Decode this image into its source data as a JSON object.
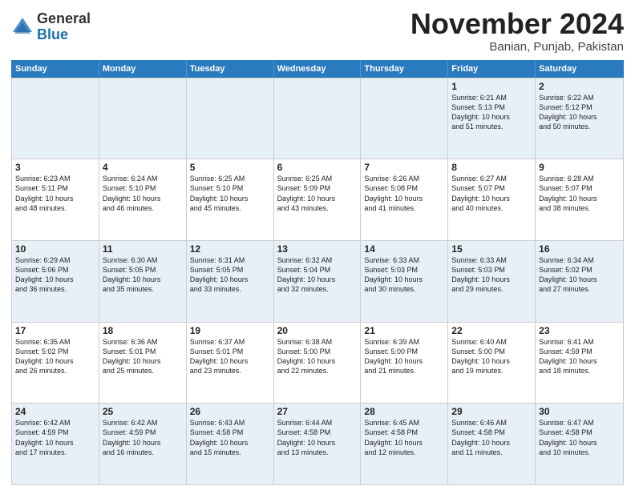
{
  "logo": {
    "general": "General",
    "blue": "Blue"
  },
  "title": "November 2024",
  "location": "Banian, Punjab, Pakistan",
  "days": [
    "Sunday",
    "Monday",
    "Tuesday",
    "Wednesday",
    "Thursday",
    "Friday",
    "Saturday"
  ],
  "rows": [
    [
      {
        "day": "",
        "lines": [],
        "empty": true
      },
      {
        "day": "",
        "lines": [],
        "empty": true
      },
      {
        "day": "",
        "lines": [],
        "empty": true
      },
      {
        "day": "",
        "lines": [],
        "empty": true
      },
      {
        "day": "",
        "lines": [],
        "empty": true
      },
      {
        "day": "1",
        "lines": [
          "Sunrise: 6:21 AM",
          "Sunset: 5:13 PM",
          "Daylight: 10 hours",
          "and 51 minutes."
        ]
      },
      {
        "day": "2",
        "lines": [
          "Sunrise: 6:22 AM",
          "Sunset: 5:12 PM",
          "Daylight: 10 hours",
          "and 50 minutes."
        ]
      }
    ],
    [
      {
        "day": "3",
        "lines": [
          "Sunrise: 6:23 AM",
          "Sunset: 5:11 PM",
          "Daylight: 10 hours",
          "and 48 minutes."
        ]
      },
      {
        "day": "4",
        "lines": [
          "Sunrise: 6:24 AM",
          "Sunset: 5:10 PM",
          "Daylight: 10 hours",
          "and 46 minutes."
        ]
      },
      {
        "day": "5",
        "lines": [
          "Sunrise: 6:25 AM",
          "Sunset: 5:10 PM",
          "Daylight: 10 hours",
          "and 45 minutes."
        ]
      },
      {
        "day": "6",
        "lines": [
          "Sunrise: 6:25 AM",
          "Sunset: 5:09 PM",
          "Daylight: 10 hours",
          "and 43 minutes."
        ]
      },
      {
        "day": "7",
        "lines": [
          "Sunrise: 6:26 AM",
          "Sunset: 5:08 PM",
          "Daylight: 10 hours",
          "and 41 minutes."
        ]
      },
      {
        "day": "8",
        "lines": [
          "Sunrise: 6:27 AM",
          "Sunset: 5:07 PM",
          "Daylight: 10 hours",
          "and 40 minutes."
        ]
      },
      {
        "day": "9",
        "lines": [
          "Sunrise: 6:28 AM",
          "Sunset: 5:07 PM",
          "Daylight: 10 hours",
          "and 38 minutes."
        ]
      }
    ],
    [
      {
        "day": "10",
        "lines": [
          "Sunrise: 6:29 AM",
          "Sunset: 5:06 PM",
          "Daylight: 10 hours",
          "and 36 minutes."
        ]
      },
      {
        "day": "11",
        "lines": [
          "Sunrise: 6:30 AM",
          "Sunset: 5:05 PM",
          "Daylight: 10 hours",
          "and 35 minutes."
        ]
      },
      {
        "day": "12",
        "lines": [
          "Sunrise: 6:31 AM",
          "Sunset: 5:05 PM",
          "Daylight: 10 hours",
          "and 33 minutes."
        ]
      },
      {
        "day": "13",
        "lines": [
          "Sunrise: 6:32 AM",
          "Sunset: 5:04 PM",
          "Daylight: 10 hours",
          "and 32 minutes."
        ]
      },
      {
        "day": "14",
        "lines": [
          "Sunrise: 6:33 AM",
          "Sunset: 5:03 PM",
          "Daylight: 10 hours",
          "and 30 minutes."
        ]
      },
      {
        "day": "15",
        "lines": [
          "Sunrise: 6:33 AM",
          "Sunset: 5:03 PM",
          "Daylight: 10 hours",
          "and 29 minutes."
        ]
      },
      {
        "day": "16",
        "lines": [
          "Sunrise: 6:34 AM",
          "Sunset: 5:02 PM",
          "Daylight: 10 hours",
          "and 27 minutes."
        ]
      }
    ],
    [
      {
        "day": "17",
        "lines": [
          "Sunrise: 6:35 AM",
          "Sunset: 5:02 PM",
          "Daylight: 10 hours",
          "and 26 minutes."
        ]
      },
      {
        "day": "18",
        "lines": [
          "Sunrise: 6:36 AM",
          "Sunset: 5:01 PM",
          "Daylight: 10 hours",
          "and 25 minutes."
        ]
      },
      {
        "day": "19",
        "lines": [
          "Sunrise: 6:37 AM",
          "Sunset: 5:01 PM",
          "Daylight: 10 hours",
          "and 23 minutes."
        ]
      },
      {
        "day": "20",
        "lines": [
          "Sunrise: 6:38 AM",
          "Sunset: 5:00 PM",
          "Daylight: 10 hours",
          "and 22 minutes."
        ]
      },
      {
        "day": "21",
        "lines": [
          "Sunrise: 6:39 AM",
          "Sunset: 5:00 PM",
          "Daylight: 10 hours",
          "and 21 minutes."
        ]
      },
      {
        "day": "22",
        "lines": [
          "Sunrise: 6:40 AM",
          "Sunset: 5:00 PM",
          "Daylight: 10 hours",
          "and 19 minutes."
        ]
      },
      {
        "day": "23",
        "lines": [
          "Sunrise: 6:41 AM",
          "Sunset: 4:59 PM",
          "Daylight: 10 hours",
          "and 18 minutes."
        ]
      }
    ],
    [
      {
        "day": "24",
        "lines": [
          "Sunrise: 6:42 AM",
          "Sunset: 4:59 PM",
          "Daylight: 10 hours",
          "and 17 minutes."
        ]
      },
      {
        "day": "25",
        "lines": [
          "Sunrise: 6:42 AM",
          "Sunset: 4:59 PM",
          "Daylight: 10 hours",
          "and 16 minutes."
        ]
      },
      {
        "day": "26",
        "lines": [
          "Sunrise: 6:43 AM",
          "Sunset: 4:58 PM",
          "Daylight: 10 hours",
          "and 15 minutes."
        ]
      },
      {
        "day": "27",
        "lines": [
          "Sunrise: 6:44 AM",
          "Sunset: 4:58 PM",
          "Daylight: 10 hours",
          "and 13 minutes."
        ]
      },
      {
        "day": "28",
        "lines": [
          "Sunrise: 6:45 AM",
          "Sunset: 4:58 PM",
          "Daylight: 10 hours",
          "and 12 minutes."
        ]
      },
      {
        "day": "29",
        "lines": [
          "Sunrise: 6:46 AM",
          "Sunset: 4:58 PM",
          "Daylight: 10 hours",
          "and 11 minutes."
        ]
      },
      {
        "day": "30",
        "lines": [
          "Sunrise: 6:47 AM",
          "Sunset: 4:58 PM",
          "Daylight: 10 hours",
          "and 10 minutes."
        ]
      }
    ]
  ],
  "altRows": [
    0,
    2,
    4
  ]
}
